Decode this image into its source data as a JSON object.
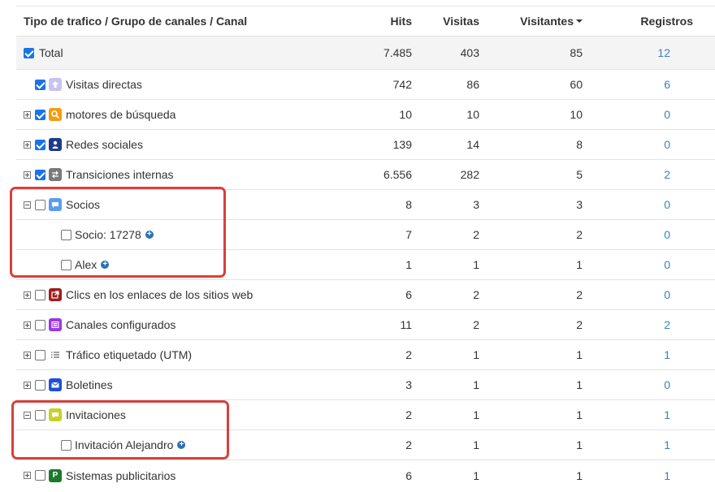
{
  "header": {
    "name": "Tipo de trafico / Grupo de canales / Canal",
    "hits": "Hits",
    "visits": "Visitas",
    "visitors": "Visitantes",
    "registrations": "Registros"
  },
  "rows": [
    {
      "label": "Total",
      "hits": "7.485",
      "visits": "403",
      "visitors": "85",
      "registrations": "12",
      "checked": true
    },
    {
      "label": "Visitas directas",
      "hits": "742",
      "visits": "86",
      "visitors": "60",
      "registrations": "6",
      "checked": true,
      "icon": "arrow-up-icon",
      "icon_color": "#c7c3f2"
    },
    {
      "label": "motores de búsqueda",
      "hits": "10",
      "visits": "10",
      "visitors": "10",
      "registrations": "0",
      "checked": true,
      "icon": "search-icon",
      "icon_color": "#f39c12"
    },
    {
      "label": "Redes sociales",
      "hits": "139",
      "visits": "14",
      "visitors": "8",
      "registrations": "0",
      "checked": true,
      "icon": "person-icon",
      "icon_color": "#1e3a8a"
    },
    {
      "label": "Transiciones internas",
      "hits": "6.556",
      "visits": "282",
      "visitors": "5",
      "registrations": "2",
      "checked": true,
      "icon": "transfer-icon",
      "icon_color": "#7a7a7a"
    },
    {
      "label": "Socios",
      "hits": "8",
      "visits": "3",
      "visitors": "3",
      "registrations": "0",
      "checked": false,
      "icon": "chat-icon",
      "icon_color": "#5b9bf2"
    },
    {
      "label": "Socio: 17278",
      "hits": "7",
      "visits": "2",
      "visitors": "2",
      "registrations": "0",
      "checked": false
    },
    {
      "label": "Alex",
      "hits": "1",
      "visits": "1",
      "visitors": "1",
      "registrations": "0",
      "checked": false
    },
    {
      "label": "Clics en los enlaces de los sitios web",
      "hits": "6",
      "visits": "2",
      "visitors": "2",
      "registrations": "0",
      "checked": false,
      "icon": "external-link-icon",
      "icon_color": "#a01d1d"
    },
    {
      "label": "Canales configurados",
      "hits": "11",
      "visits": "2",
      "visitors": "2",
      "registrations": "2",
      "checked": false,
      "icon": "list-icon",
      "icon_color": "#9b37e0"
    },
    {
      "label": "Tráfico etiquetado (UTM)",
      "hits": "2",
      "visits": "1",
      "visitors": "1",
      "registrations": "1",
      "checked": false,
      "icon": "lines-icon",
      "icon_color": "#666666"
    },
    {
      "label": "Boletines",
      "hits": "3",
      "visits": "1",
      "visitors": "1",
      "registrations": "0",
      "checked": false,
      "icon": "envelope-icon",
      "icon_color": "#1f4fd6"
    },
    {
      "label": "Invitaciones",
      "hits": "2",
      "visits": "1",
      "visitors": "1",
      "registrations": "1",
      "checked": false,
      "icon": "chat-icon",
      "icon_color": "#c8d12a"
    },
    {
      "label": "Invitación Alejandro",
      "hits": "2",
      "visits": "1",
      "visitors": "1",
      "registrations": "1",
      "checked": false
    },
    {
      "label": "Sistemas publicitarios",
      "hits": "6",
      "visits": "1",
      "visitors": "1",
      "registrations": "1",
      "checked": false,
      "icon": "p-icon",
      "icon_color": "#1b7a2b"
    }
  ],
  "colors": {
    "link": "#3a80c1",
    "highlight": "#d9403a",
    "checkbox": "#1a73e8"
  }
}
